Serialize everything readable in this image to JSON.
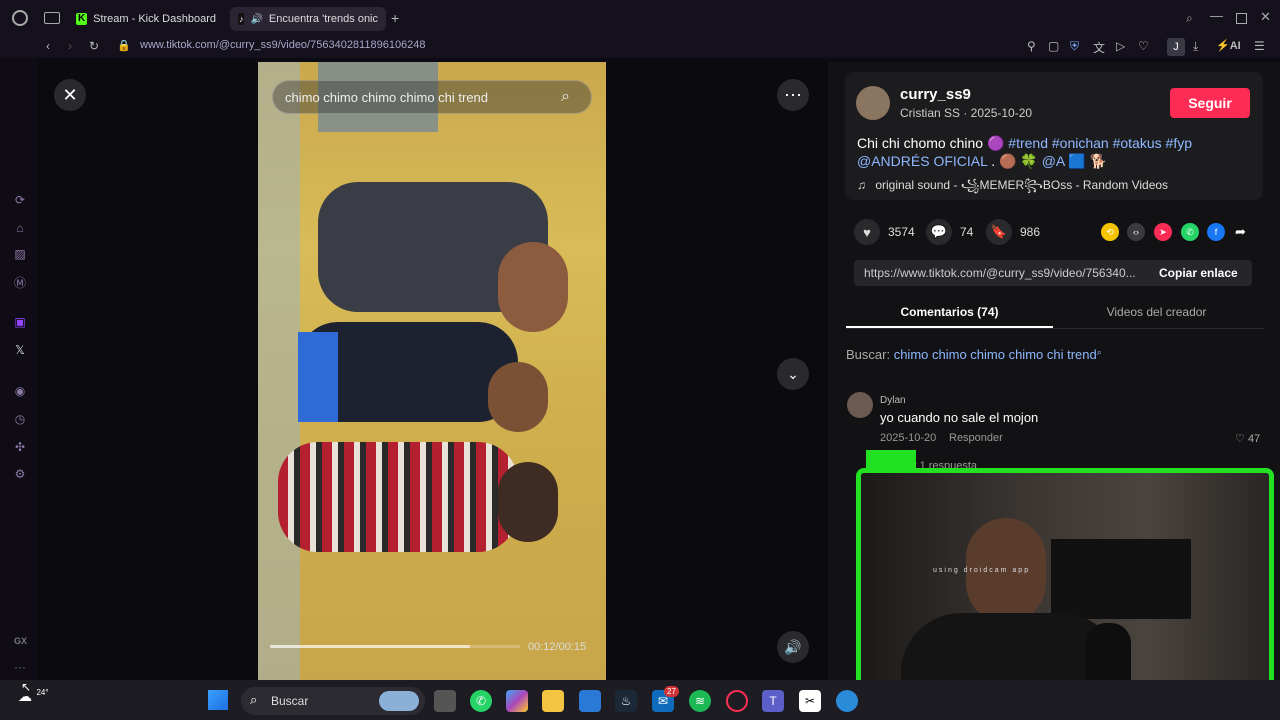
{
  "browser": {
    "tabs": [
      {
        "label": "Stream - Kick Dashboard"
      },
      {
        "label": "Encuentra 'trends onic"
      }
    ],
    "new_tab": "+",
    "url_prefix": "www.tiktok.com",
    "url_path": "/@curry_ss9/video/7563402811896106248",
    "ai_label": "AI",
    "profile_letter": "J"
  },
  "sidebar": {
    "bottom_label": "GX",
    "more": "···"
  },
  "player": {
    "search_text": "chimo chimo chimo chimo chi trend",
    "time": "00:12/00:15",
    "progress": 0.8
  },
  "post": {
    "username": "curry_ss9",
    "meta": "Cristian SS · 2025-10-20",
    "follow_label": "Seguir",
    "desc_text": "Chi chi chomo chino",
    "tags": [
      "#trend",
      "#onichan",
      "#otakus",
      "#fyp"
    ],
    "mention": "@ANDRÉS OFICIAL",
    "mention2": "@A",
    "sound": "original sound - ꧁MEMER꧂BOss - Random Videos",
    "likes": "3574",
    "comments": "74",
    "saves": "986",
    "link": "https://www.tiktok.com/@curry_ss9/video/756340...",
    "copy_label": "Copiar enlace"
  },
  "tabs": {
    "comments_label": "Comentarios (74)",
    "creator_label": "Videos del creador"
  },
  "search_line": {
    "prefix": "Buscar:",
    "query": "chimo chimo chimo chimo chi trend"
  },
  "comment": {
    "user": "Dylan",
    "text": "yo cuando no sale el mojon",
    "date": "2025-10-20",
    "reply_label": "Responder",
    "likes": "47",
    "view_replies": "Ver 1 respuesta"
  },
  "webcam": {
    "caption": "using droidcam app"
  },
  "taskbar": {
    "temp": "24°",
    "search_label": "Buscar",
    "badge": "27"
  }
}
